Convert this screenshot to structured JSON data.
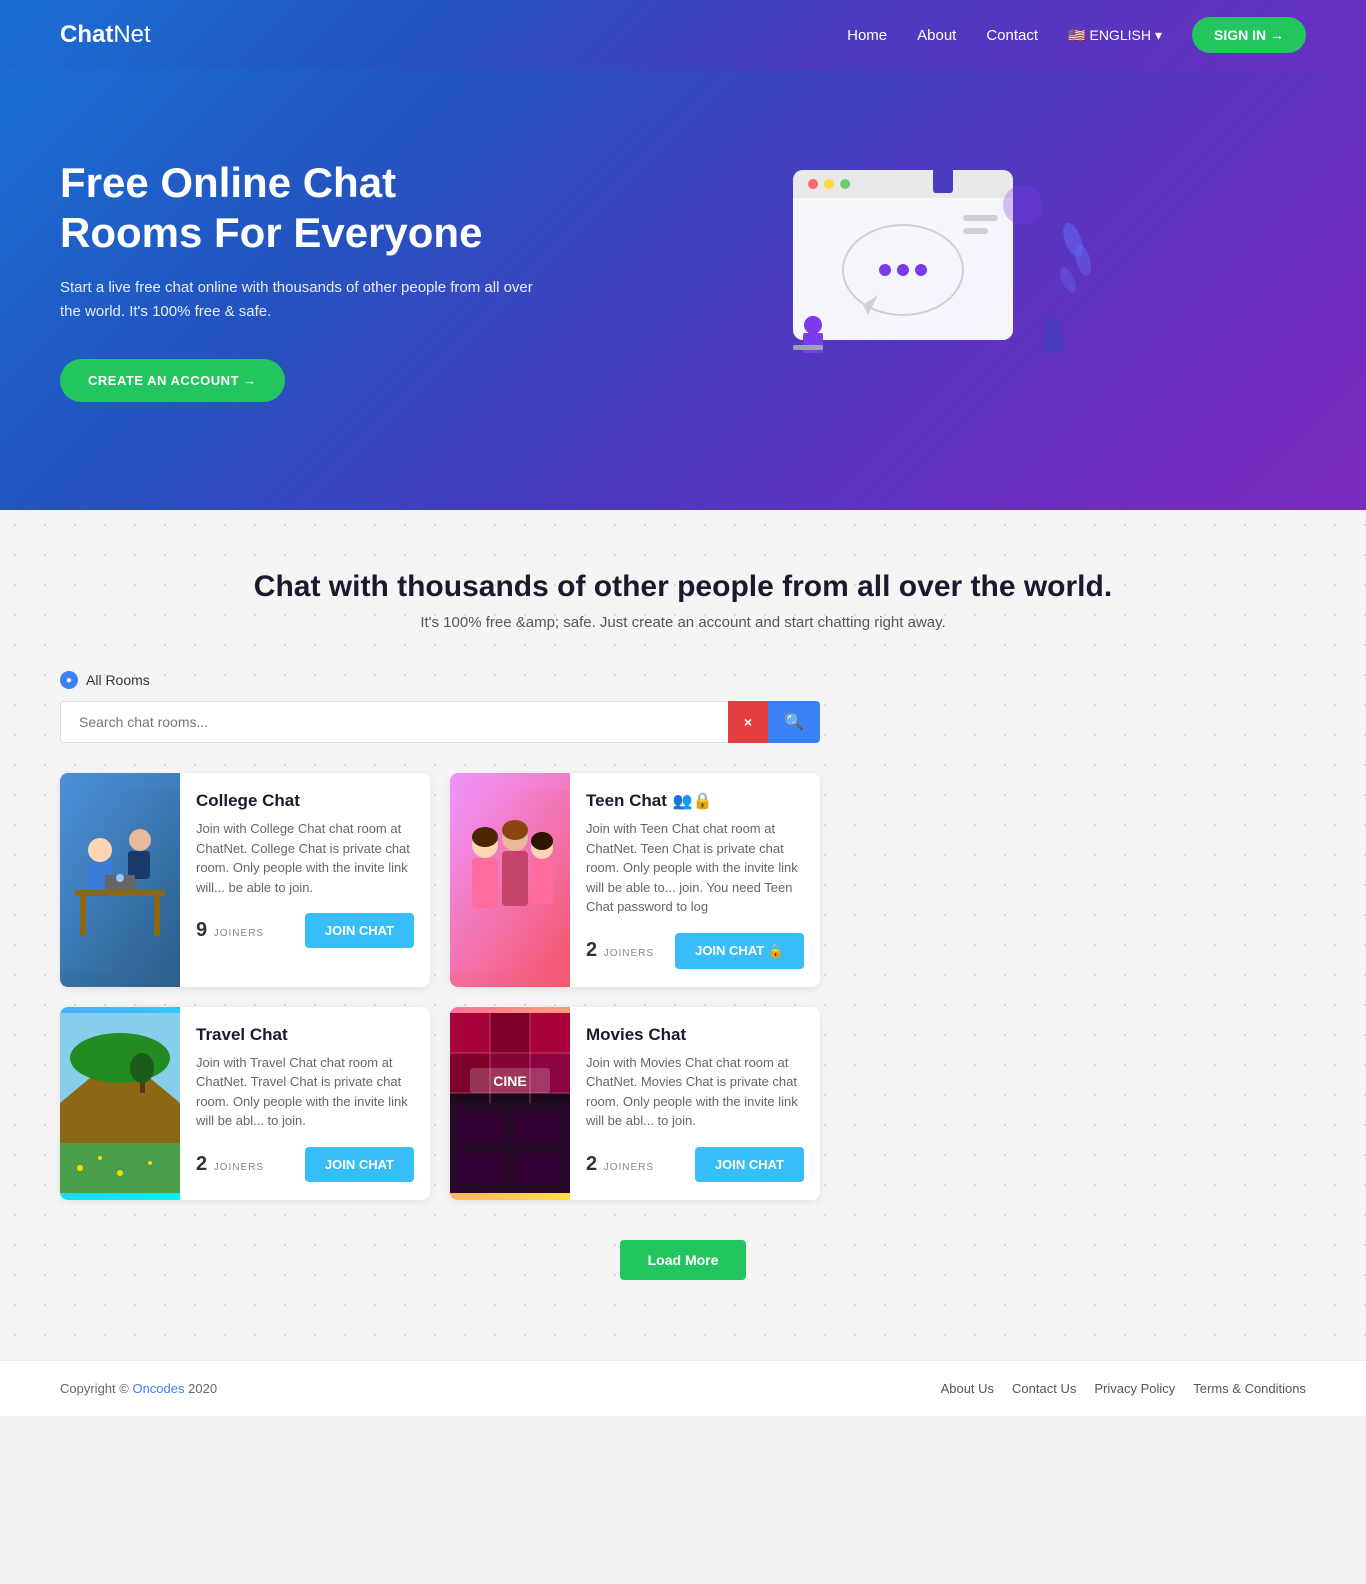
{
  "header": {
    "logo_bold": "Chat",
    "logo_light": "Net",
    "nav": {
      "home": "Home",
      "about": "About",
      "contact": "Contact",
      "language": "ENGLISH",
      "sign_in": "SIGN IN →"
    }
  },
  "hero": {
    "title": "Free Online Chat Rooms For Everyone",
    "description": "Start a live free chat online with thousands of other people from all over the world. It's 100% free & safe.",
    "cta": "CREATE AN ACCOUNT →"
  },
  "main": {
    "section_title": "Chat with thousands of other people from all over the world.",
    "section_subtitle": "It's 100% free &amp; safe. Just create an account and start chatting right away.",
    "all_rooms_label": "All Rooms",
    "search_placeholder": "Search chat rooms...",
    "search_clear": "×",
    "search_icon": "🔍",
    "rooms": [
      {
        "id": "college",
        "title": "College Chat",
        "description": "Join with College Chat chat room at ChatNet. College Chat is private chat room. Only people with the invite link will... be able to join.",
        "joiners": 9,
        "joiners_label": "JOINERS",
        "join_btn": "JOIN CHAT",
        "private": false,
        "color_from": "#4a90d9",
        "color_to": "#2c5f8a",
        "img_emoji": "🎓"
      },
      {
        "id": "teen",
        "title": "Teen Chat",
        "description": "Join with Teen Chat chat room at ChatNet. Teen Chat is private chat room. Only people with the invite link will be able to... join. You need Teen Chat password to log",
        "joiners": 2,
        "joiners_label": "JOINERS",
        "join_btn": "JOIN CHAT 🔒",
        "private": true,
        "color_from": "#f093fb",
        "color_to": "#f5576c",
        "img_emoji": "👥"
      },
      {
        "id": "travel",
        "title": "Travel Chat",
        "description": "Join with Travel Chat chat room at ChatNet. Travel Chat is private chat room. Only people with the invite link will be abl... to join.",
        "joiners": 2,
        "joiners_label": "JOINERS",
        "join_btn": "JOIN CHAT",
        "private": false,
        "color_from": "#a8edea",
        "color_to": "#6cb4a0",
        "img_emoji": "✈️"
      },
      {
        "id": "movies",
        "title": "Movies Chat",
        "description": "Join with Movies Chat chat room at ChatNet. Movies Chat is private chat room. Only people with the invite link will be abl... to join.",
        "joiners": 2,
        "joiners_label": "JOINERS",
        "join_btn": "JOIN CHAT",
        "private": false,
        "color_from": "#fa709a",
        "color_to": "#fee140",
        "img_emoji": "🎬"
      }
    ],
    "load_more": "Load More"
  },
  "footer": {
    "copyright": "Copyright © ",
    "brand": "Oncodes",
    "year": " 2020",
    "links": [
      "About Us",
      "Contact Us",
      "Privacy Policy",
      "Terms & Conditions"
    ]
  }
}
